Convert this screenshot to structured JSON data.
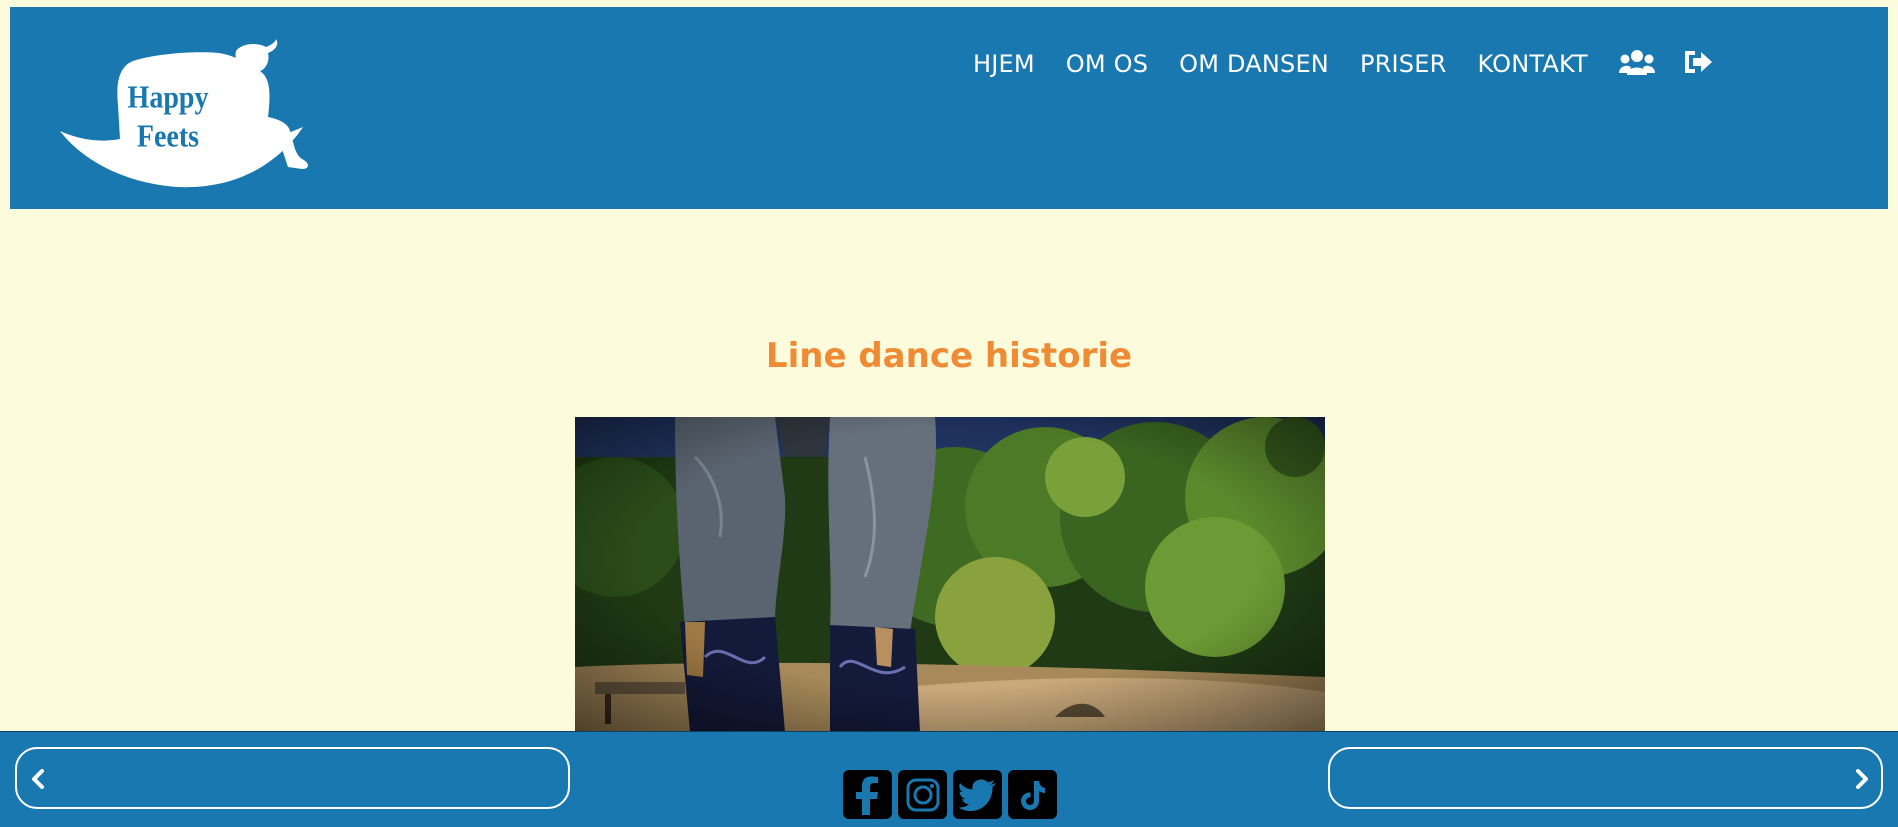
{
  "brand": {
    "logo_line1": "Happy",
    "logo_line2": "Feets",
    "logo_alt": "Happy Feets"
  },
  "nav": {
    "items": [
      {
        "label": "HJEM"
      },
      {
        "label": "OM OS"
      },
      {
        "label": "OM DANSEN"
      },
      {
        "label": "PRISER"
      },
      {
        "label": "KONTAKT"
      }
    ],
    "icons": [
      "users-icon",
      "sign-out-icon"
    ]
  },
  "main": {
    "title": "Line dance historie"
  },
  "footer": {
    "social": [
      "facebook-icon",
      "instagram-icon",
      "twitter-icon",
      "tiktok-icon"
    ],
    "prev_icon": "chevron-left-icon",
    "next_icon": "chevron-right-icon"
  },
  "colors": {
    "primary": "#1a78b1",
    "background": "#fcfcdc",
    "accent": "#ef8b34"
  }
}
